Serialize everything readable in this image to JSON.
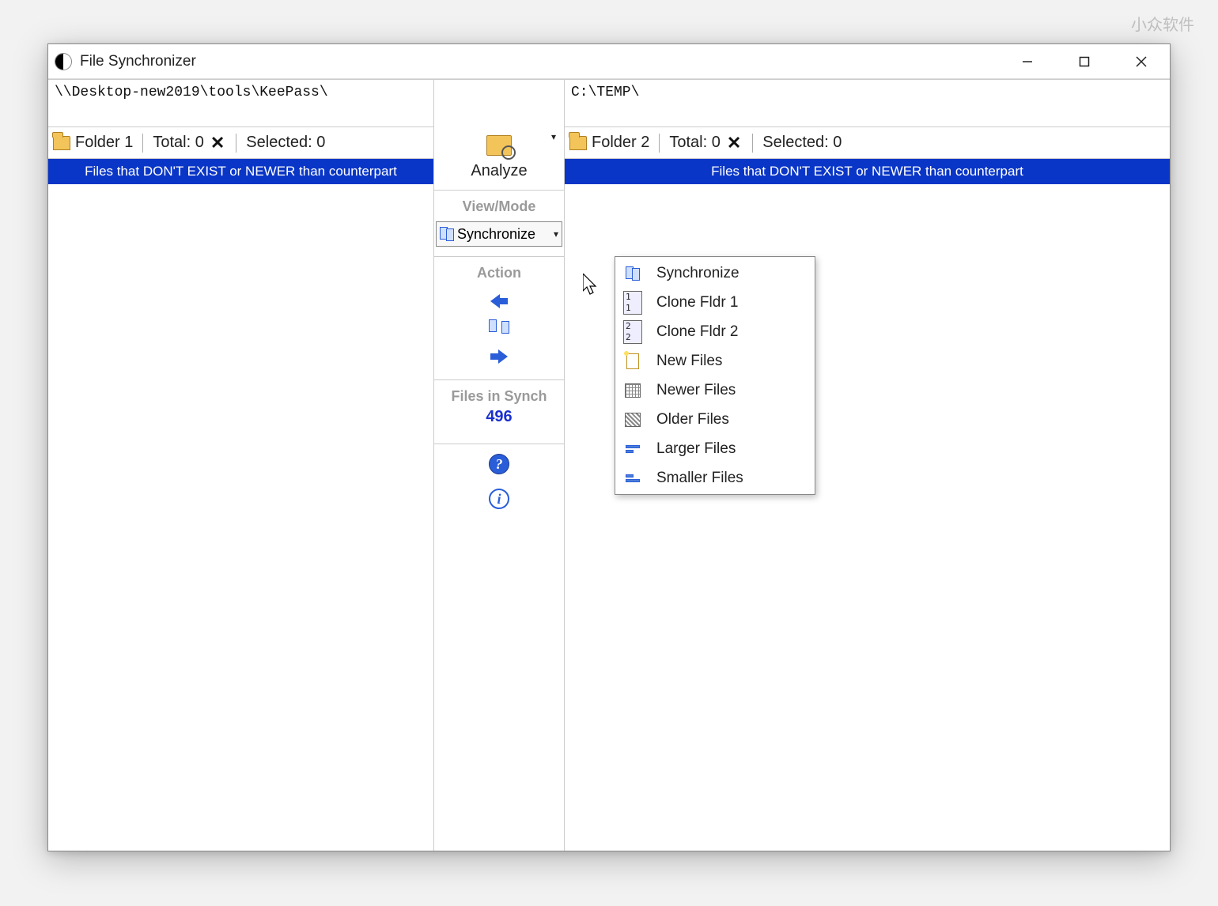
{
  "watermark": "小众软件",
  "window": {
    "title": "File Synchronizer"
  },
  "panel_left": {
    "path": "\\\\Desktop-new2019\\tools\\KeePass\\",
    "folder_label": "Folder 1",
    "total_label": "Total: 0",
    "selected_label": "Selected: 0",
    "header": "Files that DON'T EXIST or NEWER than counterpart"
  },
  "panel_right": {
    "path": "C:\\TEMP\\",
    "folder_label": "Folder 2",
    "total_label": "Total: 0",
    "selected_label": "Selected: 0",
    "header": "Files that DON'T EXIST or NEWER than counterpart"
  },
  "center": {
    "analyze_label": "Analyze",
    "viewmode_label": "View/Mode",
    "mode_selected": "Synchronize",
    "action_label": "Action",
    "files_in_synch_label": "Files in Synch",
    "files_in_synch_count": "496"
  },
  "dropdown": {
    "items": [
      "Synchronize",
      "Clone Fldr 1",
      "Clone Fldr 2",
      "New Files",
      "Newer Files",
      "Older Files",
      "Larger Files",
      "Smaller Files"
    ]
  }
}
